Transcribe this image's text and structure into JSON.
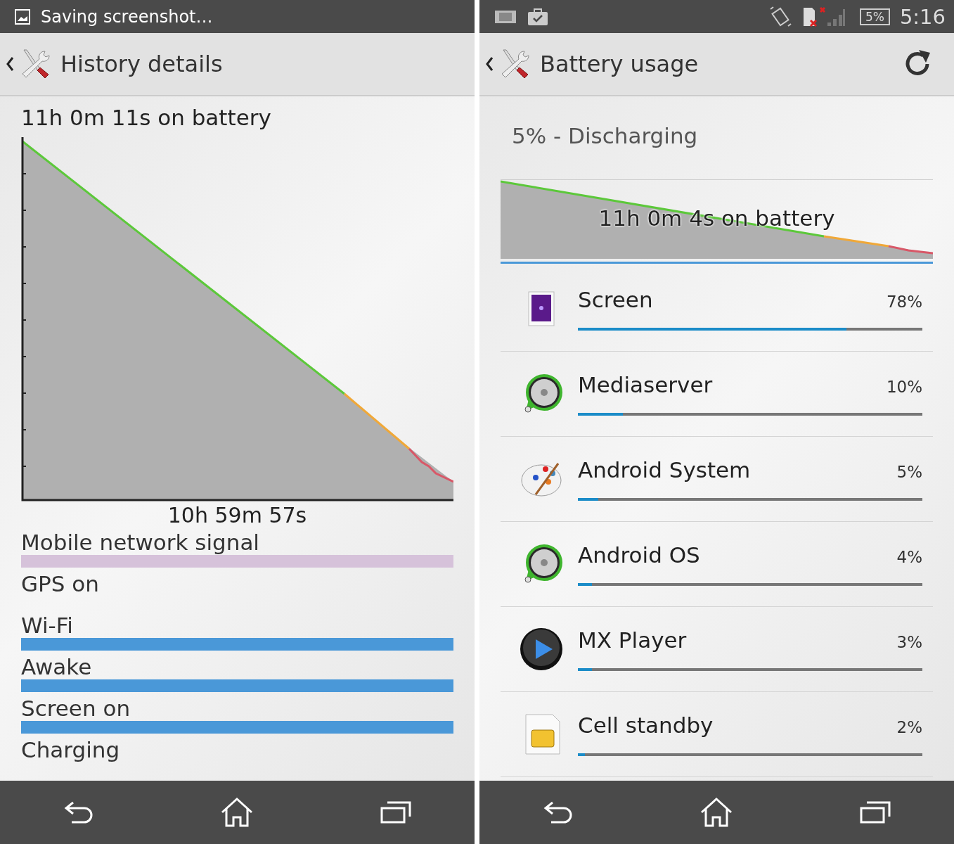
{
  "left": {
    "status_bar": {
      "notification": "Saving screenshot…"
    },
    "action_bar": {
      "title": "History details"
    },
    "history": {
      "duration": "11h 0m 11s on battery",
      "time_label": "10h 59m 57s"
    },
    "signals": [
      {
        "label": "Mobile network signal",
        "color": "#d6c2da"
      },
      {
        "label": "GPS on"
      },
      {
        "label": "Wi-Fi",
        "color": "#4a98d8"
      },
      {
        "label": "Awake",
        "color": "#4a98d8"
      },
      {
        "label": "Screen on",
        "color": "#4a98d8"
      },
      {
        "label": "Charging"
      }
    ]
  },
  "right": {
    "status_bar": {
      "battery": "5%",
      "time": "5:16"
    },
    "action_bar": {
      "title": "Battery usage"
    },
    "summary": {
      "status": "5% - Discharging",
      "graph_label": "11h 0m 4s on battery"
    },
    "apps": [
      {
        "kind": "screen",
        "name": "Screen",
        "percent": "78%",
        "level": 0.78
      },
      {
        "kind": "media",
        "name": "Mediaserver",
        "percent": "10%",
        "level": 0.13
      },
      {
        "kind": "palette",
        "name": "Android System",
        "percent": "5%",
        "level": 0.06
      },
      {
        "kind": "media",
        "name": "Android OS",
        "percent": "4%",
        "level": 0.04
      },
      {
        "kind": "player",
        "name": "MX Player",
        "percent": "3%",
        "level": 0.04
      },
      {
        "kind": "sim",
        "name": "Cell standby",
        "percent": "2%",
        "level": 0.02
      }
    ]
  }
}
